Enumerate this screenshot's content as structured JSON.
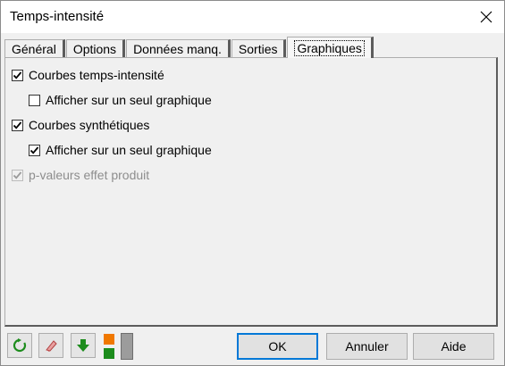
{
  "window": {
    "title": "Temps-intensité"
  },
  "tabs": [
    {
      "label": "Général",
      "active": false
    },
    {
      "label": "Options",
      "active": false
    },
    {
      "label": "Données manq.",
      "active": false
    },
    {
      "label": "Sorties",
      "active": false
    },
    {
      "label": "Graphiques",
      "active": true
    }
  ],
  "options": [
    {
      "label": "Courbes temps-intensité",
      "checked": true,
      "enabled": true
    },
    {
      "label": "Afficher sur un seul graphique",
      "checked": false,
      "enabled": true
    },
    {
      "label": "Courbes synthétiques",
      "checked": true,
      "enabled": true
    },
    {
      "label": "Afficher sur un seul graphique",
      "checked": true,
      "enabled": true
    },
    {
      "label": "p-valeurs effet produit",
      "checked": true,
      "enabled": false
    }
  ],
  "toolbar": {
    "icons": [
      "reset-icon",
      "eraser-icon",
      "download-arrow-icon",
      "layout-squares-icon"
    ]
  },
  "buttons": {
    "ok": "OK",
    "cancel": "Annuler",
    "help": "Aide"
  },
  "colors": {
    "focus_border": "#0078d7",
    "green_icon": "#1c8c1c",
    "orange_icon": "#f07800"
  }
}
